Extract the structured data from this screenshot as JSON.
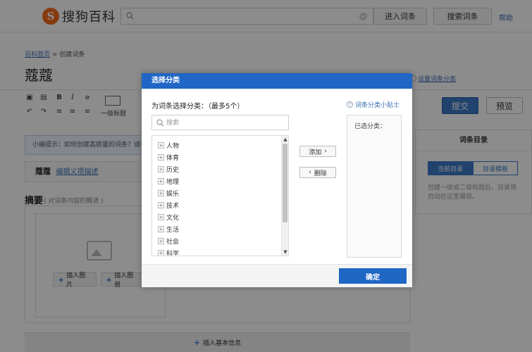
{
  "header": {
    "logo_mark": "S",
    "logo_text": "搜狗百科",
    "search_placeholder": "",
    "enter_button": "进入词条",
    "search_button": "搜索词条",
    "help_link": "帮助"
  },
  "breadcrumb": {
    "home_link": "百科首页",
    "separator": ">",
    "current": "创建词条"
  },
  "page": {
    "title": "蔻蔻",
    "set_category_link": "设置词条分类",
    "submit_button": "提交",
    "preview_button": "预览",
    "heading_tool_label": "一级标题",
    "tip_text": "小编提示：如何创建高质量的词条？请看",
    "term_name": "蔻蔻",
    "term_edit_link": "编辑义项描述",
    "abstract_label": "摘要",
    "abstract_hint": "( 对词条内容的概述 )",
    "insert_image_button": "插入图片",
    "insert_album_button": "插入图册",
    "insert_basic_info": "插入基本信息"
  },
  "toc": {
    "title": "词条目录",
    "tabs": [
      "当前目录",
      "目录模板"
    ],
    "active_tab": 0,
    "description": "创建一级或二级标题后，目录将自动在这里展现。"
  },
  "modal": {
    "title": "选择分类",
    "heading": "为词条选择分类：（最多5个）",
    "tips_link": "词条分类小贴士",
    "search_placeholder": "搜索",
    "categories": [
      "人物",
      "体育",
      "历史",
      "地理",
      "娱乐",
      "技术",
      "文化",
      "生活",
      "社会",
      "科学"
    ],
    "add_button": "添加",
    "delete_button": "删除",
    "selected_label": "已选分类：",
    "confirm_button": "确定"
  },
  "colors": {
    "brand_orange": "#f26a1b",
    "primary_blue": "#1f66c5",
    "link_blue": "#3a6fb3"
  }
}
